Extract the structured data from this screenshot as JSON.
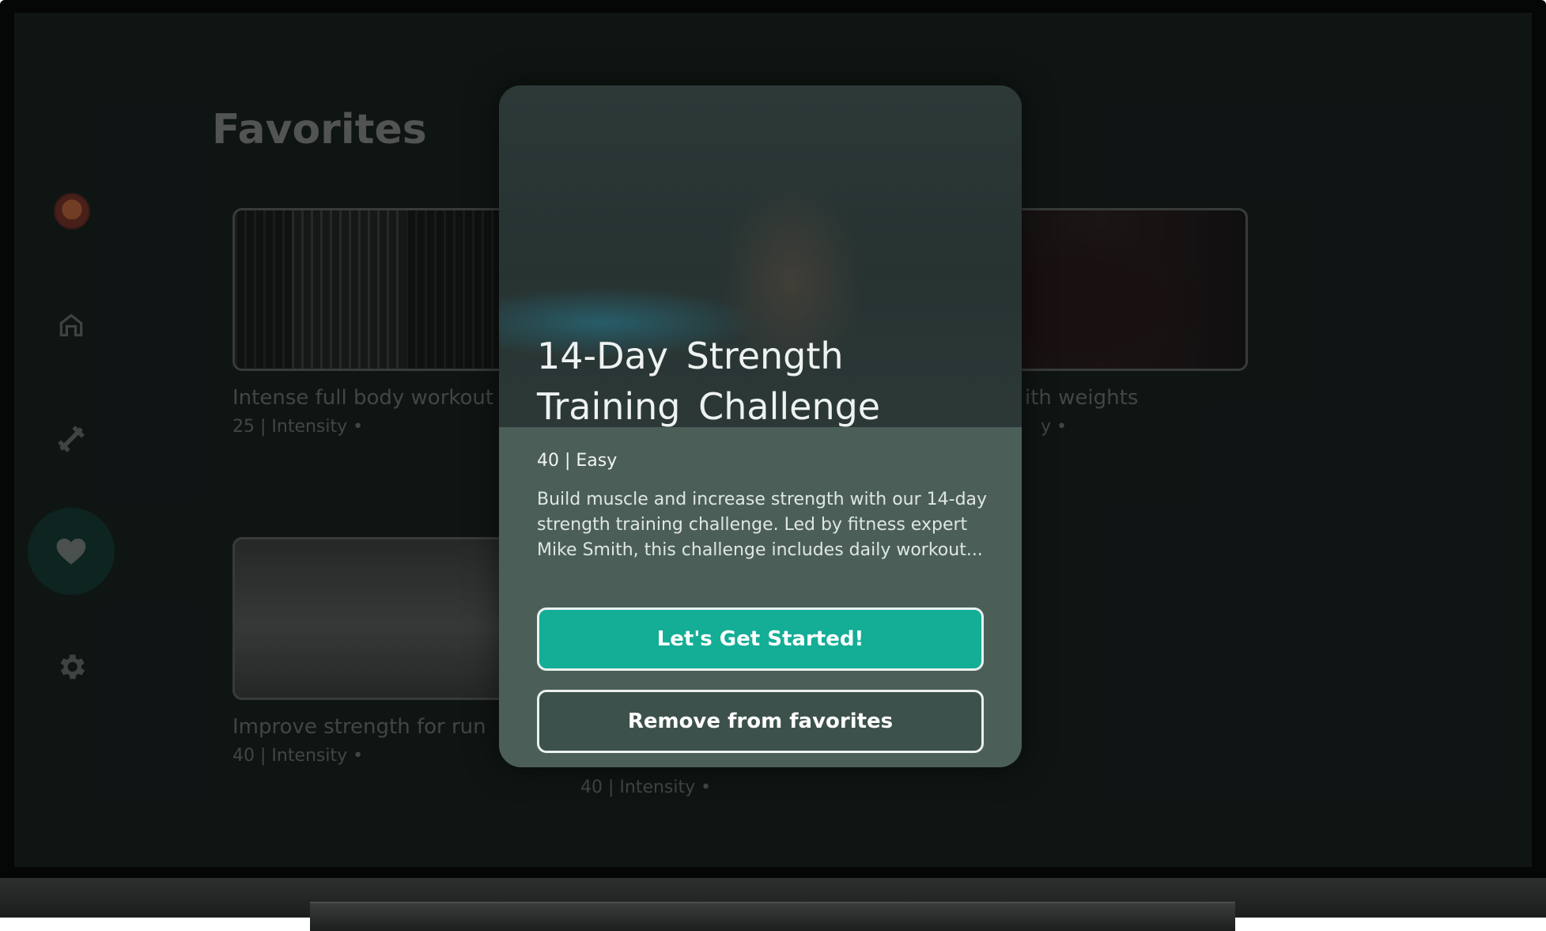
{
  "page": {
    "title": "Favorites"
  },
  "sidebar": {
    "items": [
      {
        "name": "home",
        "icon": "home-icon"
      },
      {
        "name": "workouts",
        "icon": "dumbbell-icon"
      },
      {
        "name": "favorites",
        "icon": "heart-icon",
        "active": true
      },
      {
        "name": "settings",
        "icon": "gear-icon"
      }
    ]
  },
  "cards": [
    {
      "title": "Intense full body workout",
      "meta": "25 | Intensity •"
    },
    {
      "title": "ith weights",
      "meta": "y •"
    },
    {
      "title": "Improve strength for run",
      "meta": "40 | Intensity •"
    },
    {
      "title": "",
      "meta": "40 | Intensity •"
    }
  ],
  "dialog": {
    "title": "14-Day Strength Training Challenge",
    "meta": "40 | Easy",
    "description": "Build muscle and increase strength with our 14-day strength training challenge. Led by fitness expert Mike Smith, this challenge includes daily workout...",
    "primary_button": "Let's Get Started!",
    "secondary_button": "Remove from favorites"
  },
  "colors": {
    "accent": "#14ad96",
    "dialog_bg": "#4b5f58",
    "screen_bg": "#131a19"
  }
}
